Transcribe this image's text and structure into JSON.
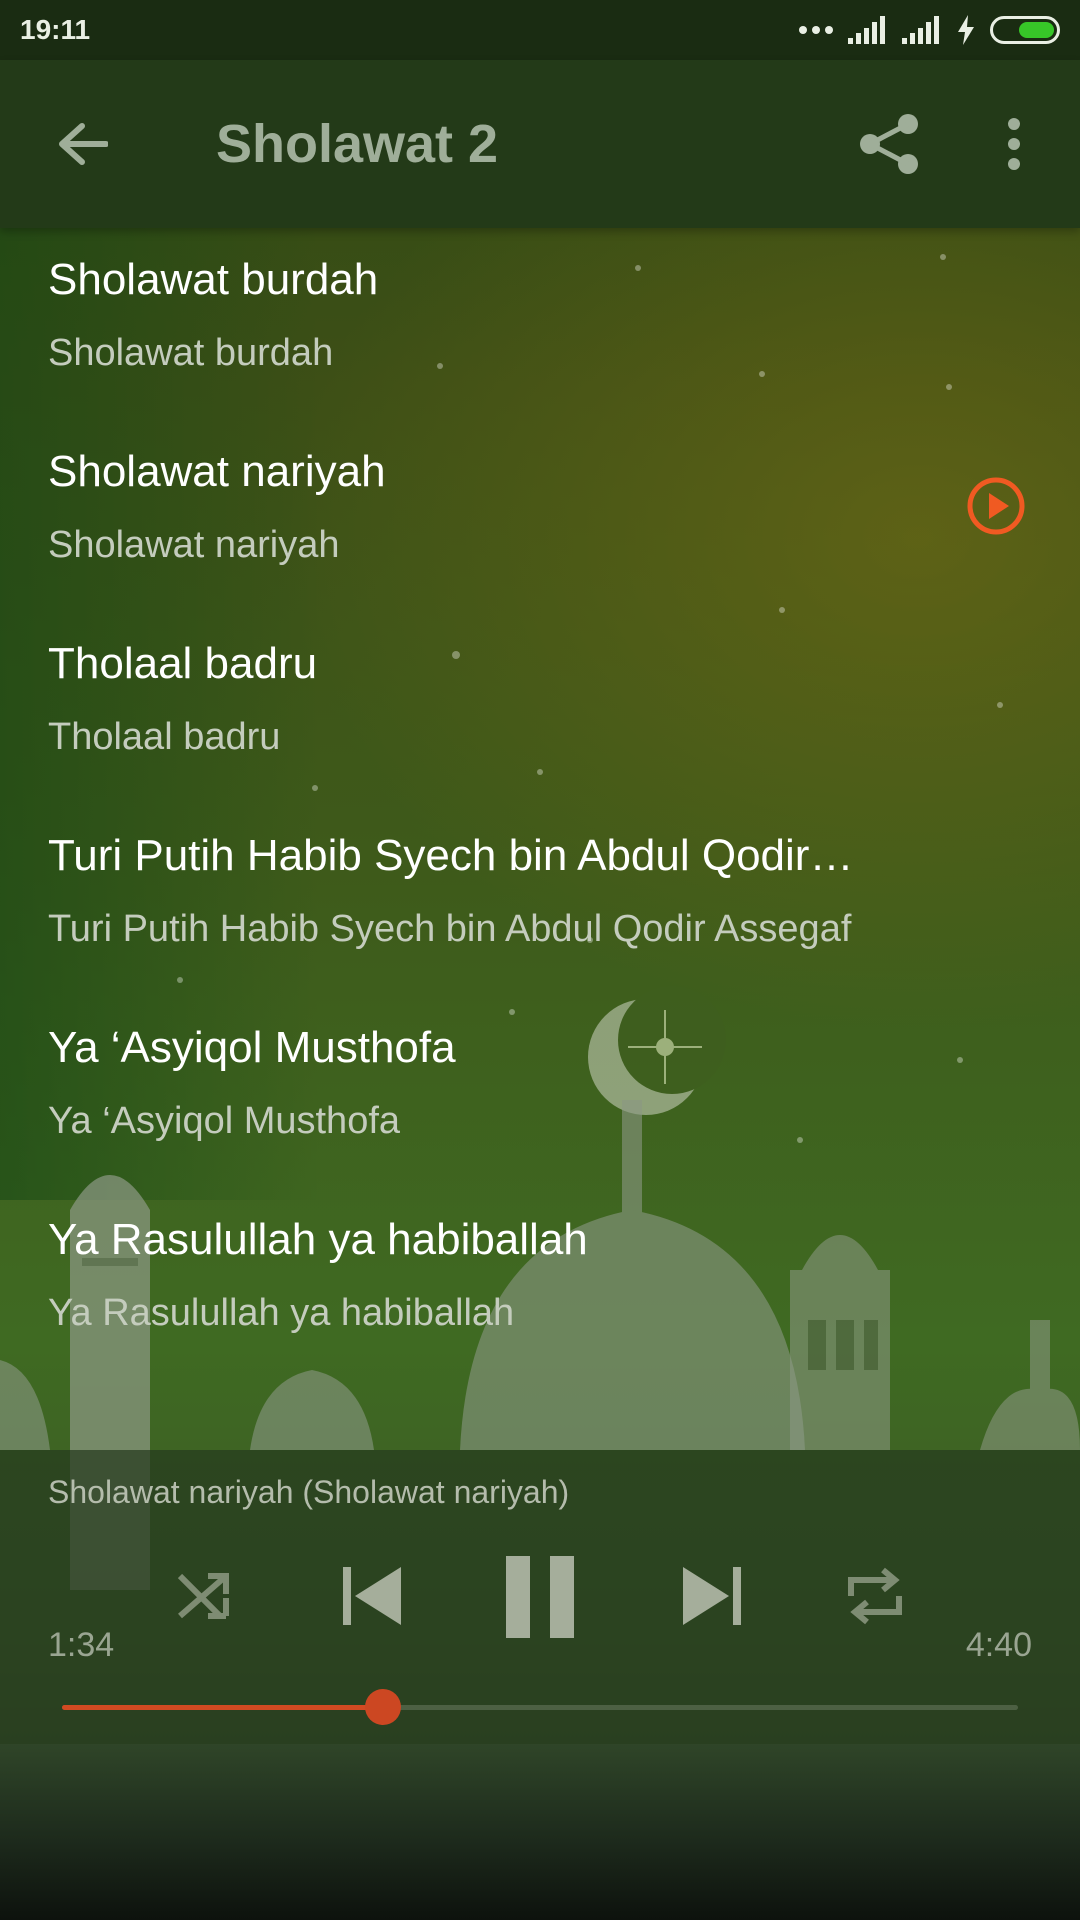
{
  "status_bar": {
    "time": "19:11"
  },
  "app_bar": {
    "title": "Sholawat 2",
    "back_icon": "arrow-left-icon",
    "share_icon": "share-icon",
    "more_icon": "more-vertical-icon"
  },
  "playlist": [
    {
      "title": "Sholawat burdah",
      "subtitle": "Sholawat burdah"
    },
    {
      "title": "Sholawat nariyah",
      "subtitle": "Sholawat nariyah",
      "playing": true
    },
    {
      "title": "Tholaal badru",
      "subtitle": "Tholaal badru"
    },
    {
      "title": "Turi Putih Habib Syech bin Abdul Qodir…",
      "subtitle": "Turi Putih Habib Syech bin Abdul Qodir Assegaf"
    },
    {
      "title": "Ya ‘Asyiqol Musthofa",
      "subtitle": "Ya ‘Asyiqol Musthofa"
    },
    {
      "title": "Ya Rasulullah ya habiballah",
      "subtitle": "Ya Rasulullah ya habiballah"
    }
  ],
  "player": {
    "now_playing": "Sholawat nariyah (Sholawat nariyah)",
    "current_time": "1:34",
    "total_time": "4:40",
    "progress": 0.336,
    "controls": [
      "shuffle-icon",
      "skip-previous-icon",
      "pause-icon",
      "skip-next-icon",
      "repeat-icon"
    ]
  },
  "colors": {
    "accent": "#f05a22",
    "seek_fill": "#d24a22",
    "app_bar": "#233a18",
    "status_bar": "#1a2c12"
  }
}
